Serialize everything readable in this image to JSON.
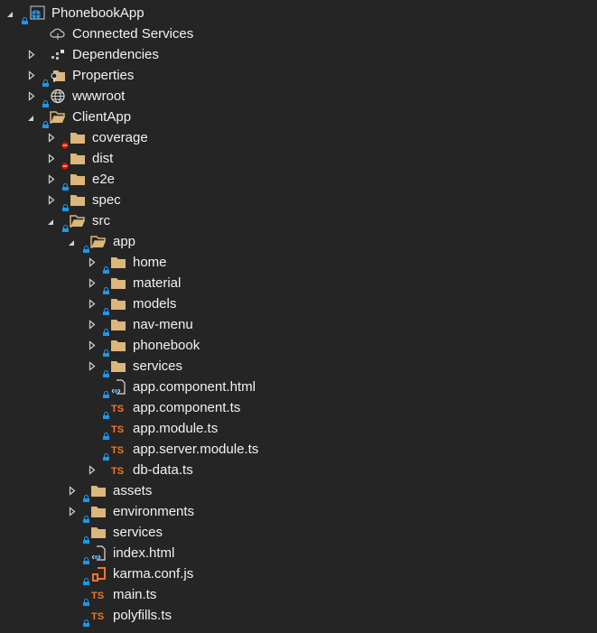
{
  "panel": "solution-explorer",
  "colors": {
    "background": "#252526",
    "text": "#f1f1f1",
    "folder": "#dcb67a",
    "lock": "#1c97ea",
    "excluded": "#e51400",
    "typescript": "#f0762a",
    "arrow": "#d0d0d0"
  },
  "items": [
    {
      "label": "PhonebookApp",
      "level": 0,
      "expander": "expanded",
      "badge": "lock",
      "icon": "web-project"
    },
    {
      "label": "Connected Services",
      "level": 1,
      "expander": "none",
      "badge": "none",
      "icon": "cloud"
    },
    {
      "label": "Dependencies",
      "level": 1,
      "expander": "collapsed",
      "badge": "none",
      "icon": "dependencies"
    },
    {
      "label": "Properties",
      "level": 1,
      "expander": "collapsed",
      "badge": "lock",
      "icon": "properties-folder"
    },
    {
      "label": "wwwroot",
      "level": 1,
      "expander": "collapsed",
      "badge": "lock",
      "icon": "globe"
    },
    {
      "label": "ClientApp",
      "level": 1,
      "expander": "expanded",
      "badge": "lock",
      "icon": "folder-open"
    },
    {
      "label": "coverage",
      "level": 2,
      "expander": "collapsed",
      "badge": "excluded",
      "icon": "folder"
    },
    {
      "label": "dist",
      "level": 2,
      "expander": "collapsed",
      "badge": "excluded",
      "icon": "folder"
    },
    {
      "label": "e2e",
      "level": 2,
      "expander": "collapsed",
      "badge": "lock",
      "icon": "folder"
    },
    {
      "label": "spec",
      "level": 2,
      "expander": "collapsed",
      "badge": "lock",
      "icon": "folder"
    },
    {
      "label": "src",
      "level": 2,
      "expander": "expanded",
      "badge": "lock",
      "icon": "folder-open"
    },
    {
      "label": "app",
      "level": 3,
      "expander": "expanded",
      "badge": "lock",
      "icon": "folder-open"
    },
    {
      "label": "home",
      "level": 4,
      "expander": "collapsed",
      "badge": "lock",
      "icon": "folder"
    },
    {
      "label": "material",
      "level": 4,
      "expander": "collapsed",
      "badge": "lock",
      "icon": "folder"
    },
    {
      "label": "models",
      "level": 4,
      "expander": "collapsed",
      "badge": "lock",
      "icon": "folder"
    },
    {
      "label": "nav-menu",
      "level": 4,
      "expander": "collapsed",
      "badge": "lock",
      "icon": "folder"
    },
    {
      "label": "phonebook",
      "level": 4,
      "expander": "collapsed",
      "badge": "lock",
      "icon": "folder"
    },
    {
      "label": "services",
      "level": 4,
      "expander": "collapsed",
      "badge": "lock",
      "icon": "folder"
    },
    {
      "label": "app.component.html",
      "level": 4,
      "expander": "none",
      "badge": "lock",
      "icon": "html-file"
    },
    {
      "label": "app.component.ts",
      "level": 4,
      "expander": "none",
      "badge": "lock",
      "icon": "typescript-file"
    },
    {
      "label": "app.module.ts",
      "level": 4,
      "expander": "none",
      "badge": "lock",
      "icon": "typescript-file"
    },
    {
      "label": "app.server.module.ts",
      "level": 4,
      "expander": "none",
      "badge": "lock",
      "icon": "typescript-file"
    },
    {
      "label": "db-data.ts",
      "level": 4,
      "expander": "collapsed",
      "badge": "none",
      "icon": "typescript-file"
    },
    {
      "label": "assets",
      "level": 3,
      "expander": "collapsed",
      "badge": "lock",
      "icon": "folder"
    },
    {
      "label": "environments",
      "level": 3,
      "expander": "collapsed",
      "badge": "lock",
      "icon": "folder"
    },
    {
      "label": "services",
      "level": 3,
      "expander": "none",
      "badge": "lock",
      "icon": "folder"
    },
    {
      "label": "index.html",
      "level": 3,
      "expander": "none",
      "badge": "lock",
      "icon": "html-file"
    },
    {
      "label": "karma.conf.js",
      "level": 3,
      "expander": "none",
      "badge": "lock",
      "icon": "js-config-file"
    },
    {
      "label": "main.ts",
      "level": 3,
      "expander": "none",
      "badge": "lock",
      "icon": "typescript-file"
    },
    {
      "label": "polyfills.ts",
      "level": 3,
      "expander": "none",
      "badge": "lock",
      "icon": "typescript-file"
    }
  ]
}
